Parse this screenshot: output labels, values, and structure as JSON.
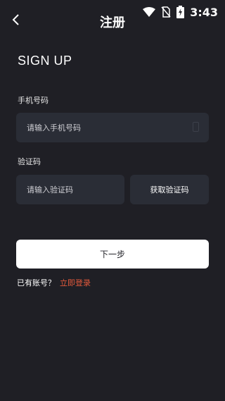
{
  "status_bar": {
    "time": "3:43",
    "icons": [
      "wifi-icon",
      "no-sim-icon",
      "battery-charging-icon"
    ]
  },
  "header": {
    "title": "注册",
    "back_icon": "chevron-left-icon"
  },
  "headline": "SIGN UP",
  "phone": {
    "label": "手机号码",
    "placeholder": "请输入手机号码",
    "trailing_icon": "phone-icon"
  },
  "code": {
    "label": "验证码",
    "placeholder": "请输入验证码",
    "get_code_label": "获取验证码"
  },
  "next_button_label": "下一步",
  "login": {
    "prompt": "已有账号？",
    "link": "立即登录"
  },
  "colors": {
    "background": "#1f1f25",
    "input_background": "#2a2d36",
    "link": "#e65a3c"
  }
}
